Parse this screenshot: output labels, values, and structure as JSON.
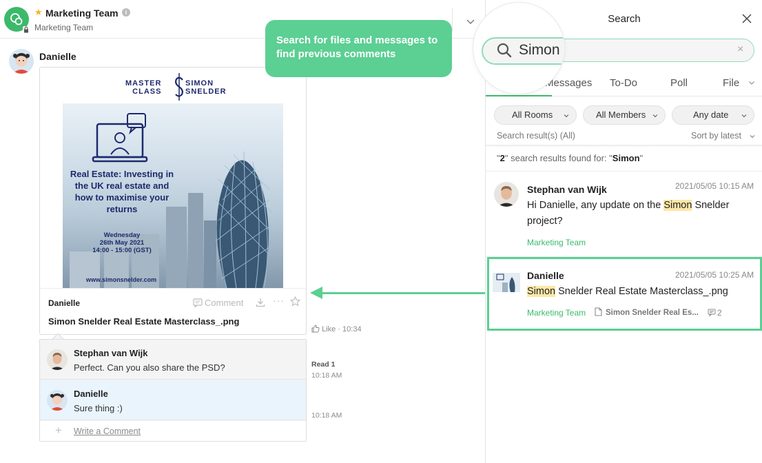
{
  "chat": {
    "room_title": "Marketing Team",
    "room_subtitle": "Marketing Team",
    "sender_name": "Danielle",
    "file_card": {
      "owner": "Danielle",
      "comment_label": "Comment",
      "file_name": "Simon Snelder Real Estate Masterclass_.png",
      "preview": {
        "logo_left": "MASTER CLASS",
        "logo_left_line1": "MASTER",
        "logo_left_line2": "CLASS",
        "logo_right_line1": "SIMON",
        "logo_right_line2": "SNELDER",
        "headline_bold": "Real Estate:",
        "headline_rest": " Investing in the UK real estate and how to maximise your returns",
        "date_line1": "Wednesday",
        "date_line2": "26th May 2021",
        "date_line3": "14:00 - 15:00 (GST)",
        "url": "www.simonsnelder.com"
      }
    },
    "like_label": "Like",
    "like_time": "10:34",
    "comments": [
      {
        "name": "Stephan van Wijk",
        "text": "Perfect. Can you also share the PSD?",
        "read": "Read 1",
        "time": "10:18 AM"
      },
      {
        "name": "Danielle",
        "text": "Sure thing :)",
        "time": "10:18 AM"
      }
    ],
    "write_comment_label": "Write a Comment"
  },
  "tooltip": {
    "text": "Search for files and messages to find previous comments"
  },
  "search": {
    "title": "Search",
    "query": "Simon",
    "tabs": [
      "Messages",
      "To-Do",
      "Poll",
      "File"
    ],
    "filters": [
      "All Rooms",
      "All Members",
      "Any date"
    ],
    "results_label": "Search result(s) (All)",
    "sort_label": "Sort by latest",
    "found_count": "2",
    "found_prefix": "\"",
    "found_middle": "\" search results found for: \"",
    "found_query": "Simon",
    "found_suffix": "\"",
    "results": [
      {
        "name": "Stephan van Wijk",
        "time": "2021/05/05 10:15 AM",
        "text_before": "Hi Danielle, any update on the ",
        "text_match": "Simon",
        "text_after": " Snelder project?",
        "room": "Marketing Team"
      },
      {
        "name": "Danielle",
        "time": "2021/05/05 10:25 AM",
        "text_before": "",
        "text_match": "Simon",
        "text_after": " Snelder Real Estate Masterclass_.png",
        "room": "Marketing Team",
        "file_label": "Simon Snelder Real Es...",
        "comment_count": "2"
      }
    ]
  },
  "colors": {
    "brand_green": "#3cb96b",
    "accent_green": "#5ccf93",
    "highlight_yellow": "#fce7a6",
    "navy": "#1e2a6b"
  }
}
